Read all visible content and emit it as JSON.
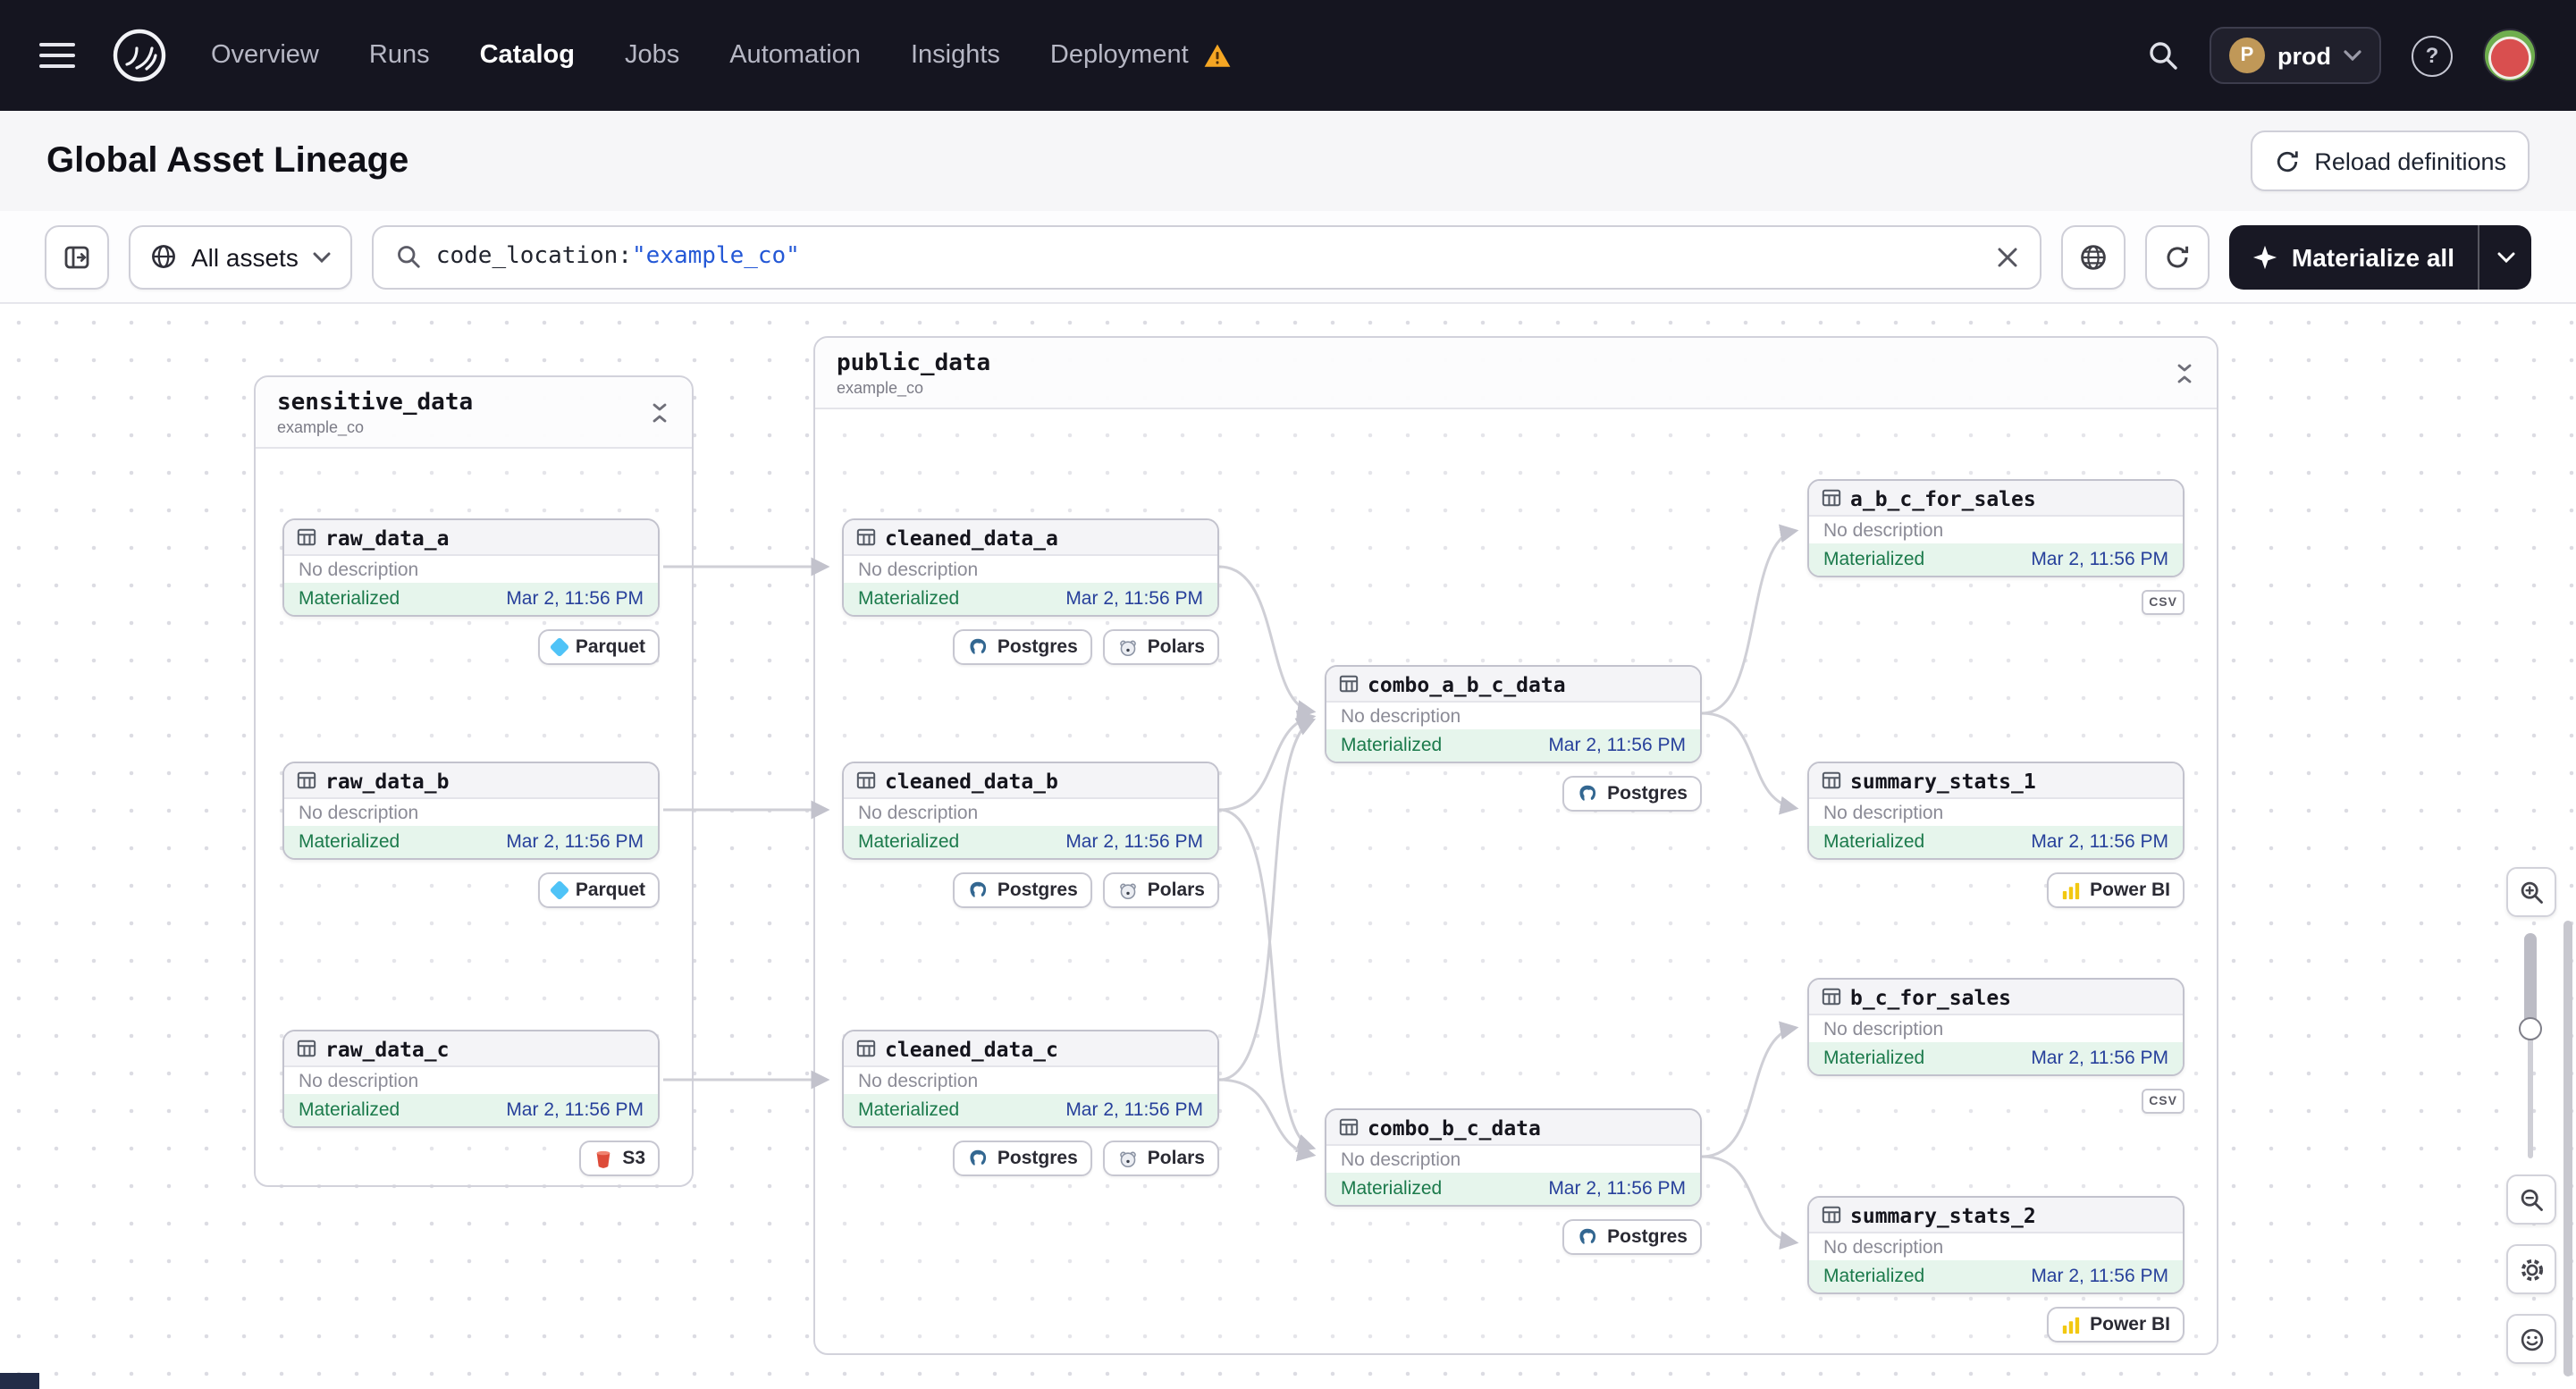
{
  "nav": {
    "items": [
      "Overview",
      "Runs",
      "Catalog",
      "Jobs",
      "Automation",
      "Insights",
      "Deployment"
    ],
    "active_item": "Catalog",
    "deployment": {
      "label": "prod",
      "initial": "P"
    },
    "help_glyph": "?"
  },
  "header": {
    "title": "Global Asset Lineage",
    "reload_button": "Reload definitions"
  },
  "toolbar": {
    "asset_filter_label": "All assets",
    "search_key": "code_location:",
    "search_value": "\"example_co\"",
    "materialize_label": "Materialize all"
  },
  "groups": [
    {
      "name": "sensitive_data",
      "code_location": "example_co"
    },
    {
      "name": "public_data",
      "code_location": "example_co"
    }
  ],
  "nodes": [
    {
      "name": "raw_data_a",
      "description": "No description",
      "status": "Materialized",
      "timestamp": "Mar 2, 11:56 PM",
      "tags": [
        {
          "type": "parquet",
          "label": "Parquet"
        }
      ]
    },
    {
      "name": "raw_data_b",
      "description": "No description",
      "status": "Materialized",
      "timestamp": "Mar 2, 11:56 PM",
      "tags": [
        {
          "type": "parquet",
          "label": "Parquet"
        }
      ]
    },
    {
      "name": "raw_data_c",
      "description": "No description",
      "status": "Materialized",
      "timestamp": "Mar 2, 11:56 PM",
      "tags": [
        {
          "type": "s3",
          "label": "S3"
        }
      ]
    },
    {
      "name": "cleaned_data_a",
      "description": "No description",
      "status": "Materialized",
      "timestamp": "Mar 2, 11:56 PM",
      "tags": [
        {
          "type": "postgres",
          "label": "Postgres"
        },
        {
          "type": "polars",
          "label": "Polars"
        }
      ]
    },
    {
      "name": "cleaned_data_b",
      "description": "No description",
      "status": "Materialized",
      "timestamp": "Mar 2, 11:56 PM",
      "tags": [
        {
          "type": "postgres",
          "label": "Postgres"
        },
        {
          "type": "polars",
          "label": "Polars"
        }
      ]
    },
    {
      "name": "cleaned_data_c",
      "description": "No description",
      "status": "Materialized",
      "timestamp": "Mar 2, 11:56 PM",
      "tags": [
        {
          "type": "postgres",
          "label": "Postgres"
        },
        {
          "type": "polars",
          "label": "Polars"
        }
      ]
    },
    {
      "name": "combo_a_b_c_data",
      "description": "No description",
      "status": "Materialized",
      "timestamp": "Mar 2, 11:56 PM",
      "tags": [
        {
          "type": "postgres",
          "label": "Postgres"
        }
      ]
    },
    {
      "name": "combo_b_c_data",
      "description": "No description",
      "status": "Materialized",
      "timestamp": "Mar 2, 11:56 PM",
      "tags": [
        {
          "type": "postgres",
          "label": "Postgres"
        }
      ]
    },
    {
      "name": "a_b_c_for_sales",
      "description": "No description",
      "status": "Materialized",
      "timestamp": "Mar 2, 11:56 PM",
      "tags": [
        {
          "type": "csv",
          "label": "CSV"
        }
      ]
    },
    {
      "name": "summary_stats_1",
      "description": "No description",
      "status": "Materialized",
      "timestamp": "Mar 2, 11:56 PM",
      "tags": [
        {
          "type": "powerbi",
          "label": "Power BI"
        }
      ]
    },
    {
      "name": "b_c_for_sales",
      "description": "No description",
      "status": "Materialized",
      "timestamp": "Mar 2, 11:56 PM",
      "tags": [
        {
          "type": "csv",
          "label": "CSV"
        }
      ]
    },
    {
      "name": "summary_stats_2",
      "description": "No description",
      "status": "Materialized",
      "timestamp": "Mar 2, 11:56 PM",
      "tags": [
        {
          "type": "powerbi",
          "label": "Power BI"
        }
      ]
    }
  ],
  "colors": {
    "nav_bg": "#151520",
    "materialized_green": "#1b7a4b",
    "materialized_bg": "#e6f5ec",
    "timestamp_blue": "#27409b",
    "warning_amber": "#f5a623",
    "search_value_blue": "#2458d6",
    "parquet_blue": "#4fc3f7",
    "postgres_blue": "#336791",
    "powerbi_yellow": "#f2c811",
    "s3_red": "#dd4b39"
  }
}
